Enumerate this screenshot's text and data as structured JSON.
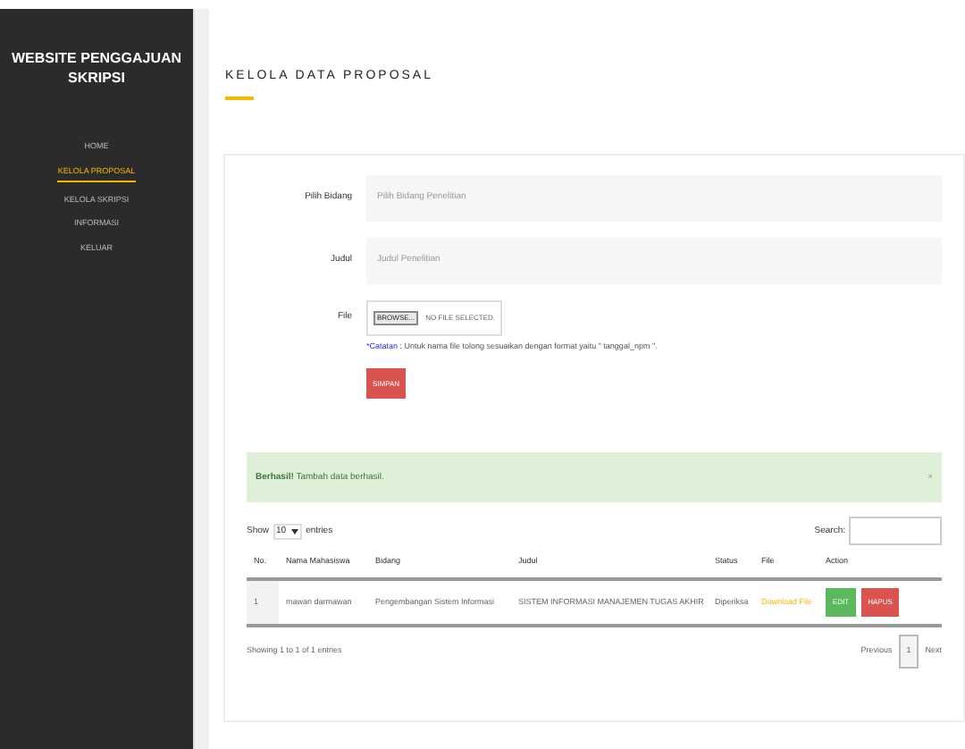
{
  "sidebar": {
    "title": "WEBSITE PENGGAJUAN SKRIPSI",
    "items": [
      {
        "label": "HOME",
        "selected": false
      },
      {
        "label": "KELOLA PROPOSAL",
        "selected": true
      },
      {
        "label": "KELOLA SKRIPSI",
        "selected": false
      },
      {
        "label": "INFORMASI",
        "selected": false
      },
      {
        "label": "KELUAR",
        "selected": false
      }
    ]
  },
  "page_title": "KELOLA DATA PROPOSAL",
  "form": {
    "fields": [
      {
        "kind": "select",
        "label": "Pilih Bidang",
        "placeholder": "Pilih Bidang Penelitian"
      },
      {
        "kind": "text",
        "label": "Judul",
        "placeholder": "Judul Penelitian"
      },
      {
        "kind": "file",
        "label": "File",
        "button": "BROWSE...",
        "value": "NO FILE SELECTED."
      }
    ],
    "note_label": "*Catatan",
    "note": " : Untuk nama file tolong sesuaikan dengan format yaitu \" tanggal_npm \".",
    "submit": "SIMPAN"
  },
  "alert": {
    "strong": "Berhasil!",
    "text": " Tambah data berhasil.",
    "close": "×"
  },
  "table": {
    "show": "Show",
    "entries_value": "10",
    "entries": "entries",
    "search_label": "Search:",
    "columns": [
      "No.",
      "Nama Mahasiswa",
      "Bidang",
      "Judul",
      "Status",
      "File",
      "Action"
    ],
    "rows": [
      {
        "no": "1",
        "nama": "mawan darmawan",
        "bidang": "Pengembangan Sistem Informasi",
        "judul": "SISTEM INFORMASI MANAJEMEN TUGAS AKHIR",
        "status": "Diperiksa",
        "file": "Download File",
        "edit": "EDIT",
        "hapus": "HAPUS"
      }
    ],
    "info": "Showing 1 to 1 of 1 entries",
    "pages": [
      {
        "label": "Previous",
        "selected": false
      },
      {
        "label": "1",
        "selected": true
      },
      {
        "label": "Next",
        "selected": false
      }
    ]
  }
}
